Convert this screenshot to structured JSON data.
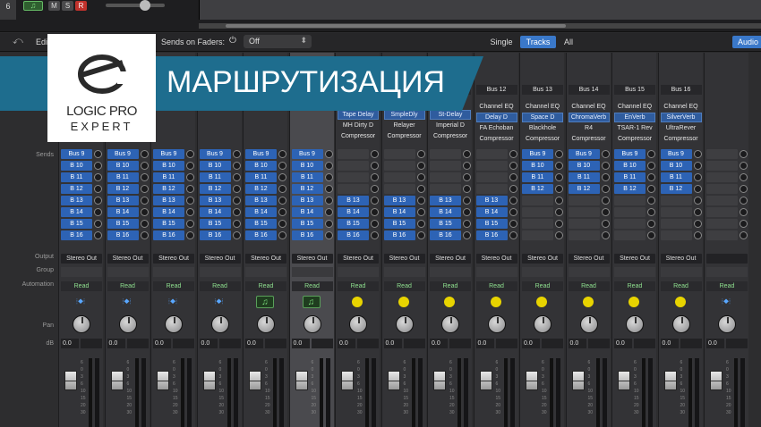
{
  "topbar": {
    "track_number": "6",
    "mute_label": "M",
    "solo_label": "S",
    "record_label": "R"
  },
  "toolbar": {
    "edit_label": "Edit",
    "sends_on_faders_label": "Sends on Faders:",
    "sends_on_faders_value": "Off",
    "view_single": "Single",
    "view_tracks": "Tracks",
    "view_all": "All",
    "audio_label": "Audio"
  },
  "branding": {
    "logo_line1": "LOGIC PRO",
    "logo_line2": "EXPERT",
    "banner_title": "МАРШРУТИЗАЦИЯ",
    "banner_color": "#1e6d8e"
  },
  "row_labels": {
    "sends": "Sends",
    "output": "Output",
    "group": "Group",
    "automation": "Automation",
    "pan": "Pan",
    "db": "dB"
  },
  "colors": {
    "send_blue": "#2d63b5",
    "read_green": "#8fe08f",
    "bus_yellow": "#e8d400",
    "instrument_green": "#7fe07f"
  },
  "strips": [
    {
      "header": "",
      "plugins": [],
      "sends": [
        "Bus 9",
        "B 10",
        "B 11",
        "B 12",
        "B 13",
        "B 14",
        "B 15",
        "B 16"
      ],
      "output": "Stereo Out",
      "automation": "Read",
      "type": "audio",
      "db": "0.0"
    },
    {
      "header": "",
      "plugins": [],
      "sends": [
        "Bus 9",
        "B 10",
        "B 11",
        "B 12",
        "B 13",
        "B 14",
        "B 15",
        "B 16"
      ],
      "output": "Stereo Out",
      "automation": "Read",
      "type": "audio",
      "db": "0.0"
    },
    {
      "header": "",
      "plugins": [],
      "sends": [
        "Bus 9",
        "B 10",
        "B 11",
        "B 12",
        "B 13",
        "B 14",
        "B 15",
        "B 16"
      ],
      "output": "Stereo Out",
      "automation": "Read",
      "type": "audio",
      "db": "0.0"
    },
    {
      "header": "",
      "plugins": [],
      "sends": [
        "Bus 9",
        "B 10",
        "B 11",
        "B 12",
        "B 13",
        "B 14",
        "B 15",
        "B 16"
      ],
      "output": "Stereo Out",
      "automation": "Read",
      "type": "audio",
      "db": "0.0"
    },
    {
      "header": "",
      "plugins": [],
      "sends": [
        "Bus 9",
        "B 10",
        "B 11",
        "B 12",
        "B 13",
        "B 14",
        "B 15",
        "B 16"
      ],
      "output": "Stereo Out",
      "automation": "Read",
      "type": "inst",
      "db": "0.0"
    },
    {
      "header": "",
      "plugins": [],
      "sends": [
        "Bus 9",
        "B 10",
        "B 11",
        "B 12",
        "B 13",
        "B 14",
        "B 15",
        "B 16"
      ],
      "output": "Stereo Out",
      "automation": "Read",
      "type": "inst",
      "db": "0.0",
      "selected": true
    },
    {
      "header": "",
      "plugins": [
        "Tape Delay",
        "MH Dirty D",
        "Compressor"
      ],
      "sends": [
        "",
        "",
        "",
        "",
        "B 13",
        "B 14",
        "B 15",
        "B 16"
      ],
      "output": "Stereo Out",
      "automation": "Read",
      "type": "bus",
      "db": "0.0"
    },
    {
      "header": "",
      "plugins": [
        "SmpleDly",
        "Relayer",
        "Compressor"
      ],
      "sends": [
        "",
        "",
        "",
        "",
        "B 13",
        "B 14",
        "B 15",
        "B 16"
      ],
      "output": "Stereo Out",
      "automation": "Read",
      "type": "bus",
      "db": "0.0"
    },
    {
      "header": "",
      "plugins": [
        "St-Delay",
        "Imperial D",
        "Compressor"
      ],
      "sends": [
        "",
        "",
        "",
        "",
        "B 13",
        "B 14",
        "B 15",
        "B 16"
      ],
      "output": "Stereo Out",
      "automation": "Read",
      "type": "bus",
      "db": "0.0"
    },
    {
      "header": "Bus 12",
      "plugins": [
        "Channel EQ",
        "Delay D",
        "FA Echoban",
        "Compressor"
      ],
      "sends": [
        "",
        "",
        "",
        "",
        "B 13",
        "B 14",
        "B 15",
        "B 16"
      ],
      "output": "Stereo Out",
      "automation": "Read",
      "type": "bus",
      "db": "0.0"
    },
    {
      "header": "Bus 13",
      "plugins": [
        "Channel EQ",
        "Space D",
        "Blackhole",
        "Compressor"
      ],
      "sends": [
        "Bus 9",
        "B 10",
        "B 11",
        "B 12",
        "",
        "",
        "",
        ""
      ],
      "output": "Stereo Out",
      "automation": "Read",
      "type": "bus",
      "db": "0.0"
    },
    {
      "header": "Bus 14",
      "plugins": [
        "Channel EQ",
        "ChromaVerb",
        "R4",
        "Compressor"
      ],
      "sends": [
        "Bus 9",
        "B 10",
        "B 11",
        "B 12",
        "",
        "",
        "",
        ""
      ],
      "output": "Stereo Out",
      "automation": "Read",
      "type": "bus",
      "db": "0.0"
    },
    {
      "header": "Bus 15",
      "plugins": [
        "Channel EQ",
        "EnVerb",
        "TSAR-1 Rev",
        "Compressor"
      ],
      "sends": [
        "Bus 9",
        "B 10",
        "B 11",
        "B 12",
        "",
        "",
        "",
        ""
      ],
      "output": "Stereo Out",
      "automation": "Read",
      "type": "bus",
      "db": "0.0"
    },
    {
      "header": "Bus 16",
      "plugins": [
        "Channel EQ",
        "SilverVerb",
        "UltraRever",
        "Compressor"
      ],
      "sends": [
        "Bus 9",
        "B 10",
        "B 11",
        "B 12",
        "",
        "",
        "",
        ""
      ],
      "output": "Stereo Out",
      "automation": "Read",
      "type": "bus",
      "db": "0.0"
    },
    {
      "header": "",
      "plugins": [],
      "sends": [
        "",
        "",
        "",
        "",
        "",
        "",
        "",
        ""
      ],
      "output": "",
      "automation": "Read",
      "type": "audio",
      "db": "0.0"
    }
  ],
  "fader_scale": [
    "6",
    "0",
    "3",
    "6",
    "10",
    "15",
    "20",
    "30"
  ]
}
